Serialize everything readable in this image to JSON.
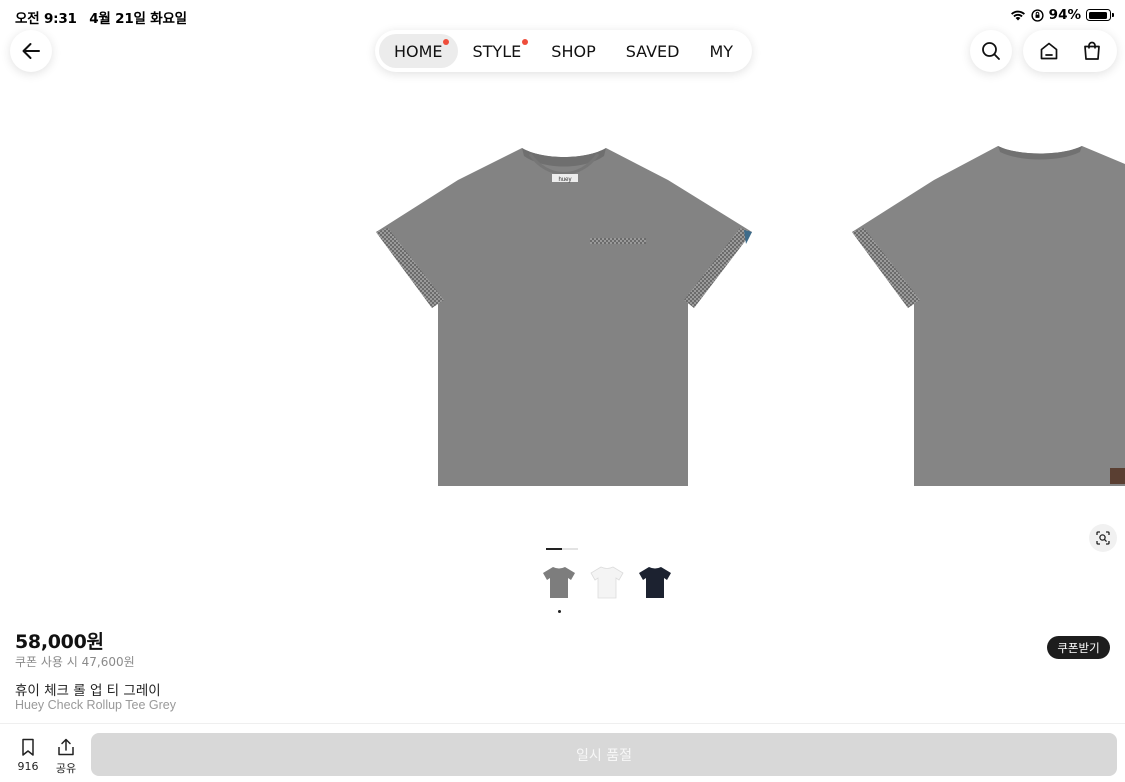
{
  "status_bar": {
    "time": "오전 9:31",
    "date": "4월 21일 화요일",
    "battery_percent": "94%",
    "battery_level": 0.94
  },
  "header": {
    "tabs": [
      {
        "label": "HOME",
        "active": true,
        "dot": true
      },
      {
        "label": "STYLE",
        "active": false,
        "dot": true
      },
      {
        "label": "SHOP",
        "active": false,
        "dot": false
      },
      {
        "label": "SAVED",
        "active": false,
        "dot": false
      },
      {
        "label": "MY",
        "active": false,
        "dot": false
      }
    ],
    "icons": [
      "back-arrow-icon",
      "search-icon",
      "home-icon",
      "shopping-bag-icon"
    ],
    "notification_dot_color": "#ef4d3b"
  },
  "gallery": {
    "current_image": 1,
    "total_images": 2,
    "color_swatches": [
      {
        "color": "grey",
        "hex": "#7d7d7d",
        "selected": true
      },
      {
        "color": "white",
        "hex": "#f4f4f4",
        "selected": false
      },
      {
        "color": "navy",
        "hex": "#1c2230",
        "selected": false
      }
    ]
  },
  "product": {
    "price": "58,000원",
    "coupon_price": "쿠폰 사용 시 47,600원",
    "coupon_button": "쿠폰받기",
    "name_ko": "휴이 체크 롤 업 티 그레이",
    "name_en": "Huey Check Rollup Tee Grey",
    "tag_text": "huey"
  },
  "bottom_bar": {
    "save_count": "916",
    "share_label": "공유",
    "action_button": "일시 품절"
  }
}
